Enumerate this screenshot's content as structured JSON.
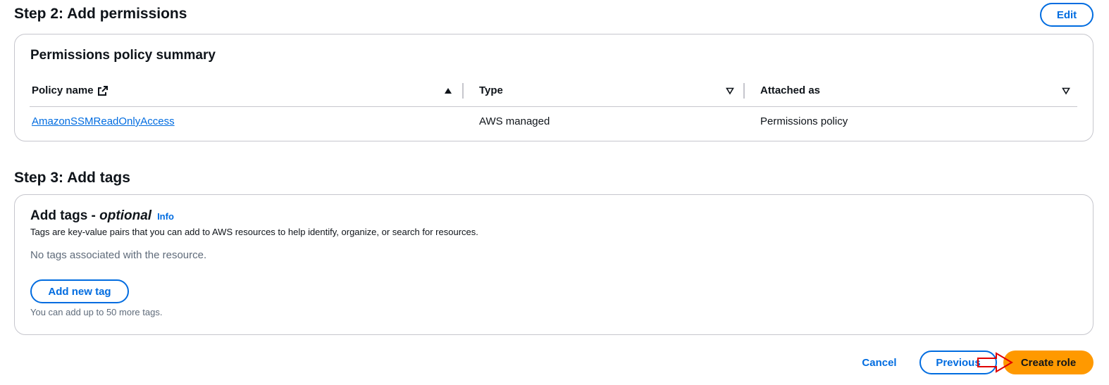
{
  "step2": {
    "title": "Step 2: Add permissions",
    "edit_label": "Edit",
    "panel_title": "Permissions policy summary",
    "columns": [
      "Policy name",
      "Type",
      "Attached as"
    ],
    "rows": [
      {
        "policy_name": "AmazonSSMReadOnlyAccess",
        "type": "AWS managed",
        "attached_as": "Permissions policy"
      }
    ]
  },
  "step3": {
    "title": "Step 3: Add tags",
    "panel_title": "Add tags - ",
    "panel_title_optional": "optional",
    "info_label": "Info",
    "description": "Tags are key-value pairs that you can add to AWS resources to help identify, organize, or search for resources.",
    "empty_message": "No tags associated with the resource.",
    "add_tag_label": "Add new tag",
    "limit_hint": "You can add up to 50 more tags."
  },
  "footer": {
    "cancel_label": "Cancel",
    "previous_label": "Previous",
    "create_label": "Create role"
  },
  "colors": {
    "link": "#006ce0",
    "primary_button": "#ff9900",
    "annotation_arrow": "#e00000"
  },
  "icons": {
    "external_link": "external-link-icon",
    "sort_ascending": "sort-ascending-icon",
    "sort_descending": "sort-descending-icon",
    "annotation": "annotation-arrow-icon"
  }
}
